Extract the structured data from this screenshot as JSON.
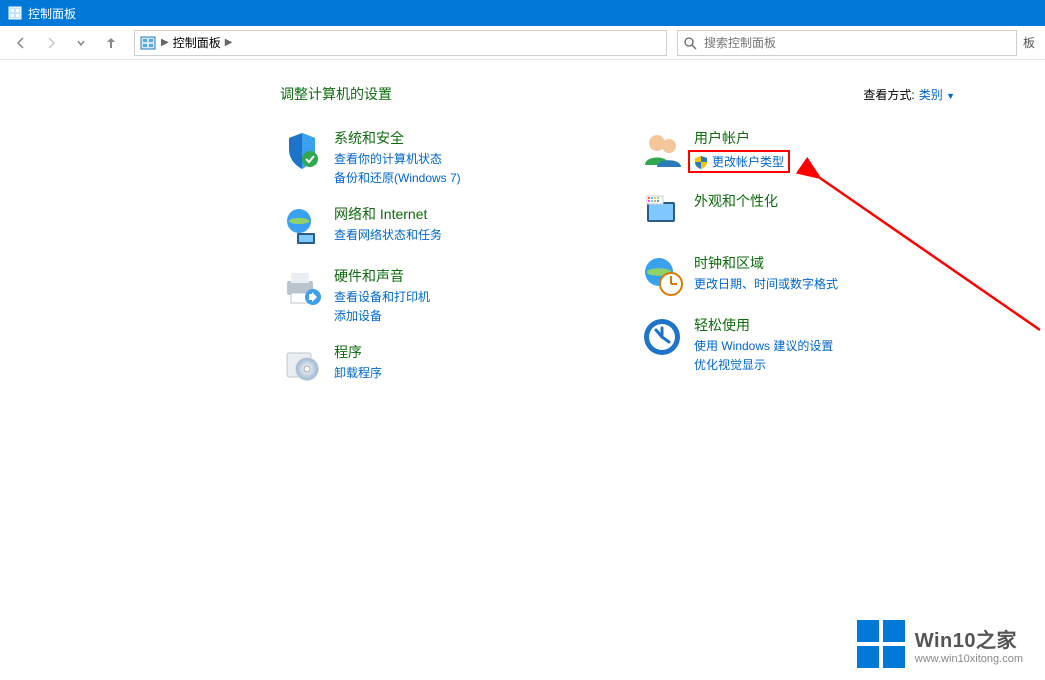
{
  "window": {
    "title": "控制面板",
    "breadcrumb_label": "控制面板",
    "search_placeholder": "搜索控制面板",
    "after_search_char": "板"
  },
  "header": {
    "heading": "调整计算机的设置",
    "viewby_label": "查看方式:",
    "viewby_value": "类别"
  },
  "left_col": [
    {
      "title": "系统和安全",
      "links": [
        "查看你的计算机状态",
        "备份和还原(Windows 7)"
      ],
      "icon": "shield"
    },
    {
      "title": "网络和 Internet",
      "links": [
        "查看网络状态和任务"
      ],
      "icon": "network"
    },
    {
      "title": "硬件和声音",
      "links": [
        "查看设备和打印机",
        "添加设备"
      ],
      "icon": "hardware"
    },
    {
      "title": "程序",
      "links": [
        "卸载程序"
      ],
      "icon": "programs"
    }
  ],
  "right_col": [
    {
      "title": "用户帐户",
      "links": [
        "更改帐户类型"
      ],
      "shield_on_link": true,
      "highlighted_link": 0,
      "icon": "users"
    },
    {
      "title": "外观和个性化",
      "links": [],
      "icon": "appearance"
    },
    {
      "title": "时钟和区域",
      "links": [
        "更改日期、时间或数字格式"
      ],
      "icon": "clock"
    },
    {
      "title": "轻松使用",
      "links": [
        "使用 Windows 建议的设置",
        "优化视觉显示"
      ],
      "icon": "ease"
    }
  ],
  "watermark": {
    "title": "Win10之家",
    "subtitle": "www.win10xitong.com"
  }
}
